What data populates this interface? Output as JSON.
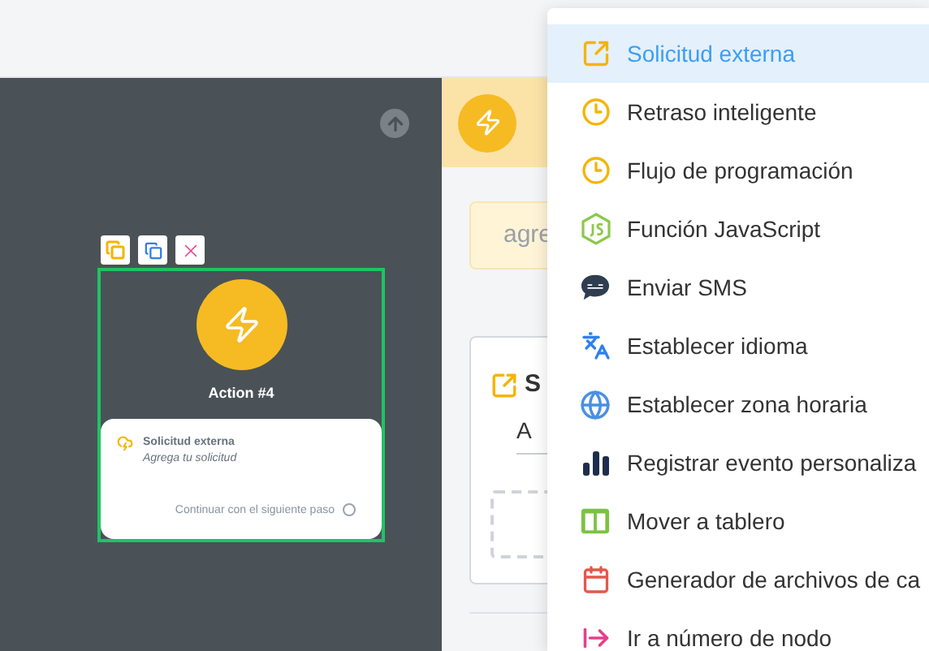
{
  "canvas": {
    "node": {
      "title": "Action #4",
      "selected": true,
      "step": {
        "title": "Solicitud externa",
        "subtitle": "Agrega tu solicitud",
        "next_label": "Continuar con el siguiente paso"
      }
    }
  },
  "panel": {
    "note": "agre",
    "card": {
      "title": "S",
      "tab": "A"
    }
  },
  "menu": {
    "items": [
      {
        "label": "Solicitud externa",
        "kind": "external",
        "selected": true
      },
      {
        "label": "Retraso inteligente",
        "kind": "clock",
        "selected": false
      },
      {
        "label": "Flujo de programación",
        "kind": "clock",
        "selected": false
      },
      {
        "label": "Función JavaScript",
        "kind": "js",
        "selected": false
      },
      {
        "label": "Enviar SMS",
        "kind": "sms",
        "selected": false
      },
      {
        "label": "Establecer idioma",
        "kind": "language",
        "selected": false
      },
      {
        "label": "Establecer zona horaria",
        "kind": "globe",
        "selected": false
      },
      {
        "label": "Registrar evento personaliza",
        "kind": "chart",
        "selected": false
      },
      {
        "label": "Mover a tablero",
        "kind": "board",
        "selected": false
      },
      {
        "label": "Generador de archivos de ca",
        "kind": "calendar",
        "selected": false
      },
      {
        "label": "Ir a número de nodo",
        "kind": "goto",
        "selected": false
      }
    ]
  }
}
